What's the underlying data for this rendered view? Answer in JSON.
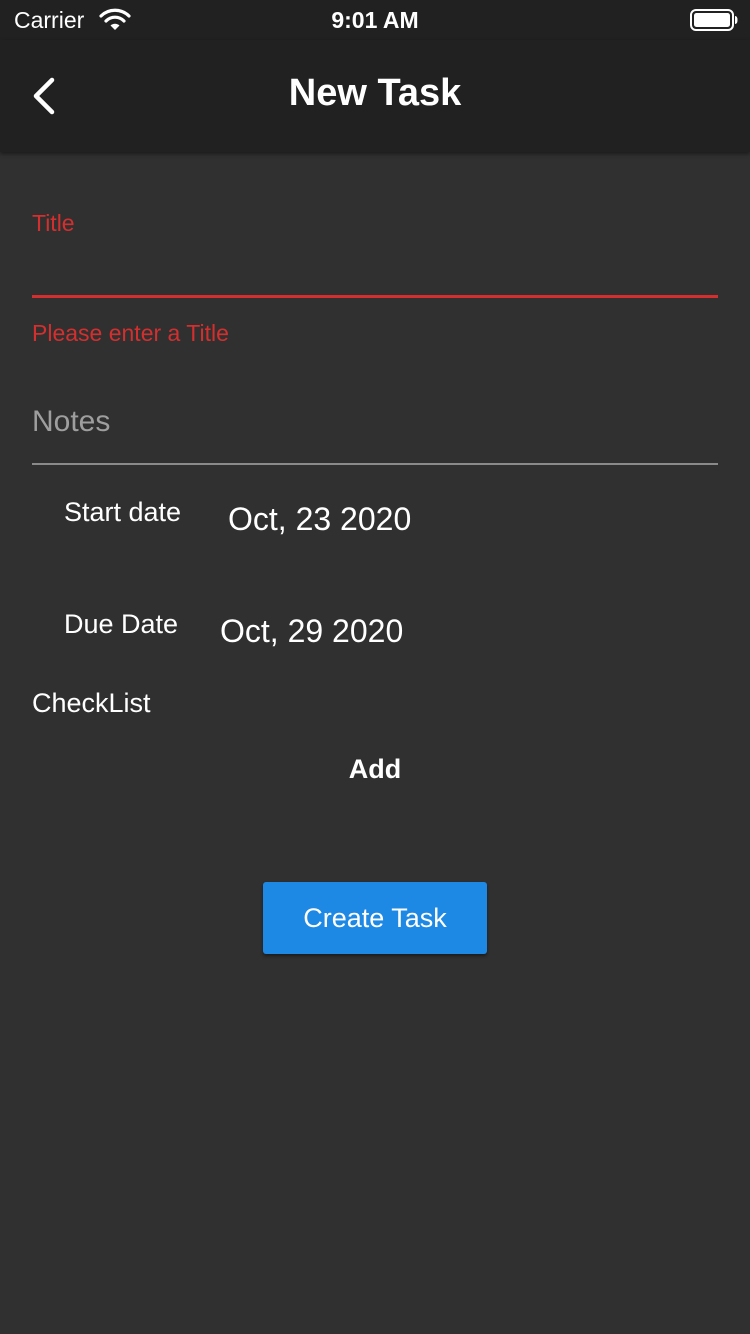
{
  "status_bar": {
    "carrier": "Carrier",
    "time": "9:01 AM"
  },
  "app_bar": {
    "title": "New Task",
    "back_icon": "chevron-left-icon"
  },
  "form": {
    "title_label": "Title",
    "title_value": "",
    "title_error": "Please enter a Title",
    "notes_placeholder": "Notes",
    "notes_value": "",
    "start_date_label": "Start date",
    "start_date_value": "Oct, 23 2020",
    "due_date_label": "Due Date",
    "due_date_value": "Oct, 29 2020",
    "checklist_label": "CheckList",
    "add_label": "Add",
    "create_label": "Create Task"
  },
  "colors": {
    "background": "#303030",
    "app_bar": "#212121",
    "error": "#d32f2f",
    "primary_button": "#1e88e5"
  }
}
